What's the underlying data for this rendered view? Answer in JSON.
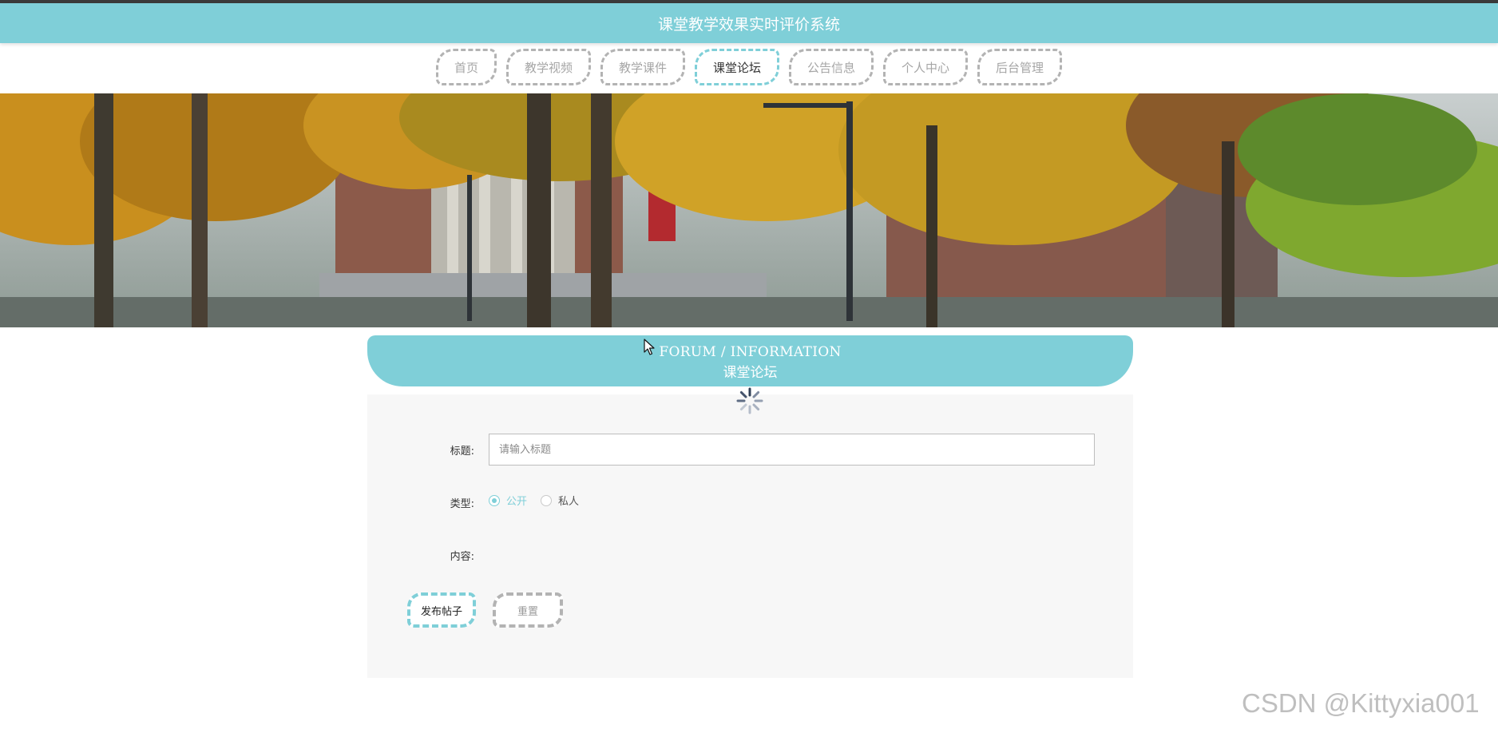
{
  "header": {
    "title": "课堂教学效果实时评价系统"
  },
  "nav": {
    "items": [
      {
        "label": "首页",
        "active": false
      },
      {
        "label": "教学视频",
        "active": false
      },
      {
        "label": "教学课件",
        "active": false
      },
      {
        "label": "课堂论坛",
        "active": true
      },
      {
        "label": "公告信息",
        "active": false
      },
      {
        "label": "个人中心",
        "active": false
      },
      {
        "label": "后台管理",
        "active": false
      }
    ]
  },
  "section": {
    "title_en": "FORUM / INFORMATION",
    "title_cn": "课堂论坛"
  },
  "form": {
    "title_label": "标题:",
    "title_placeholder": "请输入标题",
    "title_value": "",
    "type_label": "类型:",
    "type_options": [
      {
        "label": "公开",
        "checked": true
      },
      {
        "label": "私人",
        "checked": false
      }
    ],
    "content_label": "内容:",
    "submit_label": "发布帖子",
    "reset_label": "重置"
  },
  "watermark": "CSDN @Kittyxia001",
  "colors": {
    "accent": "#7fcfd8",
    "top_line": "#3a3a3a",
    "panel_bg": "#f7f7f7",
    "muted_border": "#b3b3b3"
  },
  "icons": {
    "cursor": "arrow-cursor-icon",
    "loading": "loading-spinner-icon"
  }
}
